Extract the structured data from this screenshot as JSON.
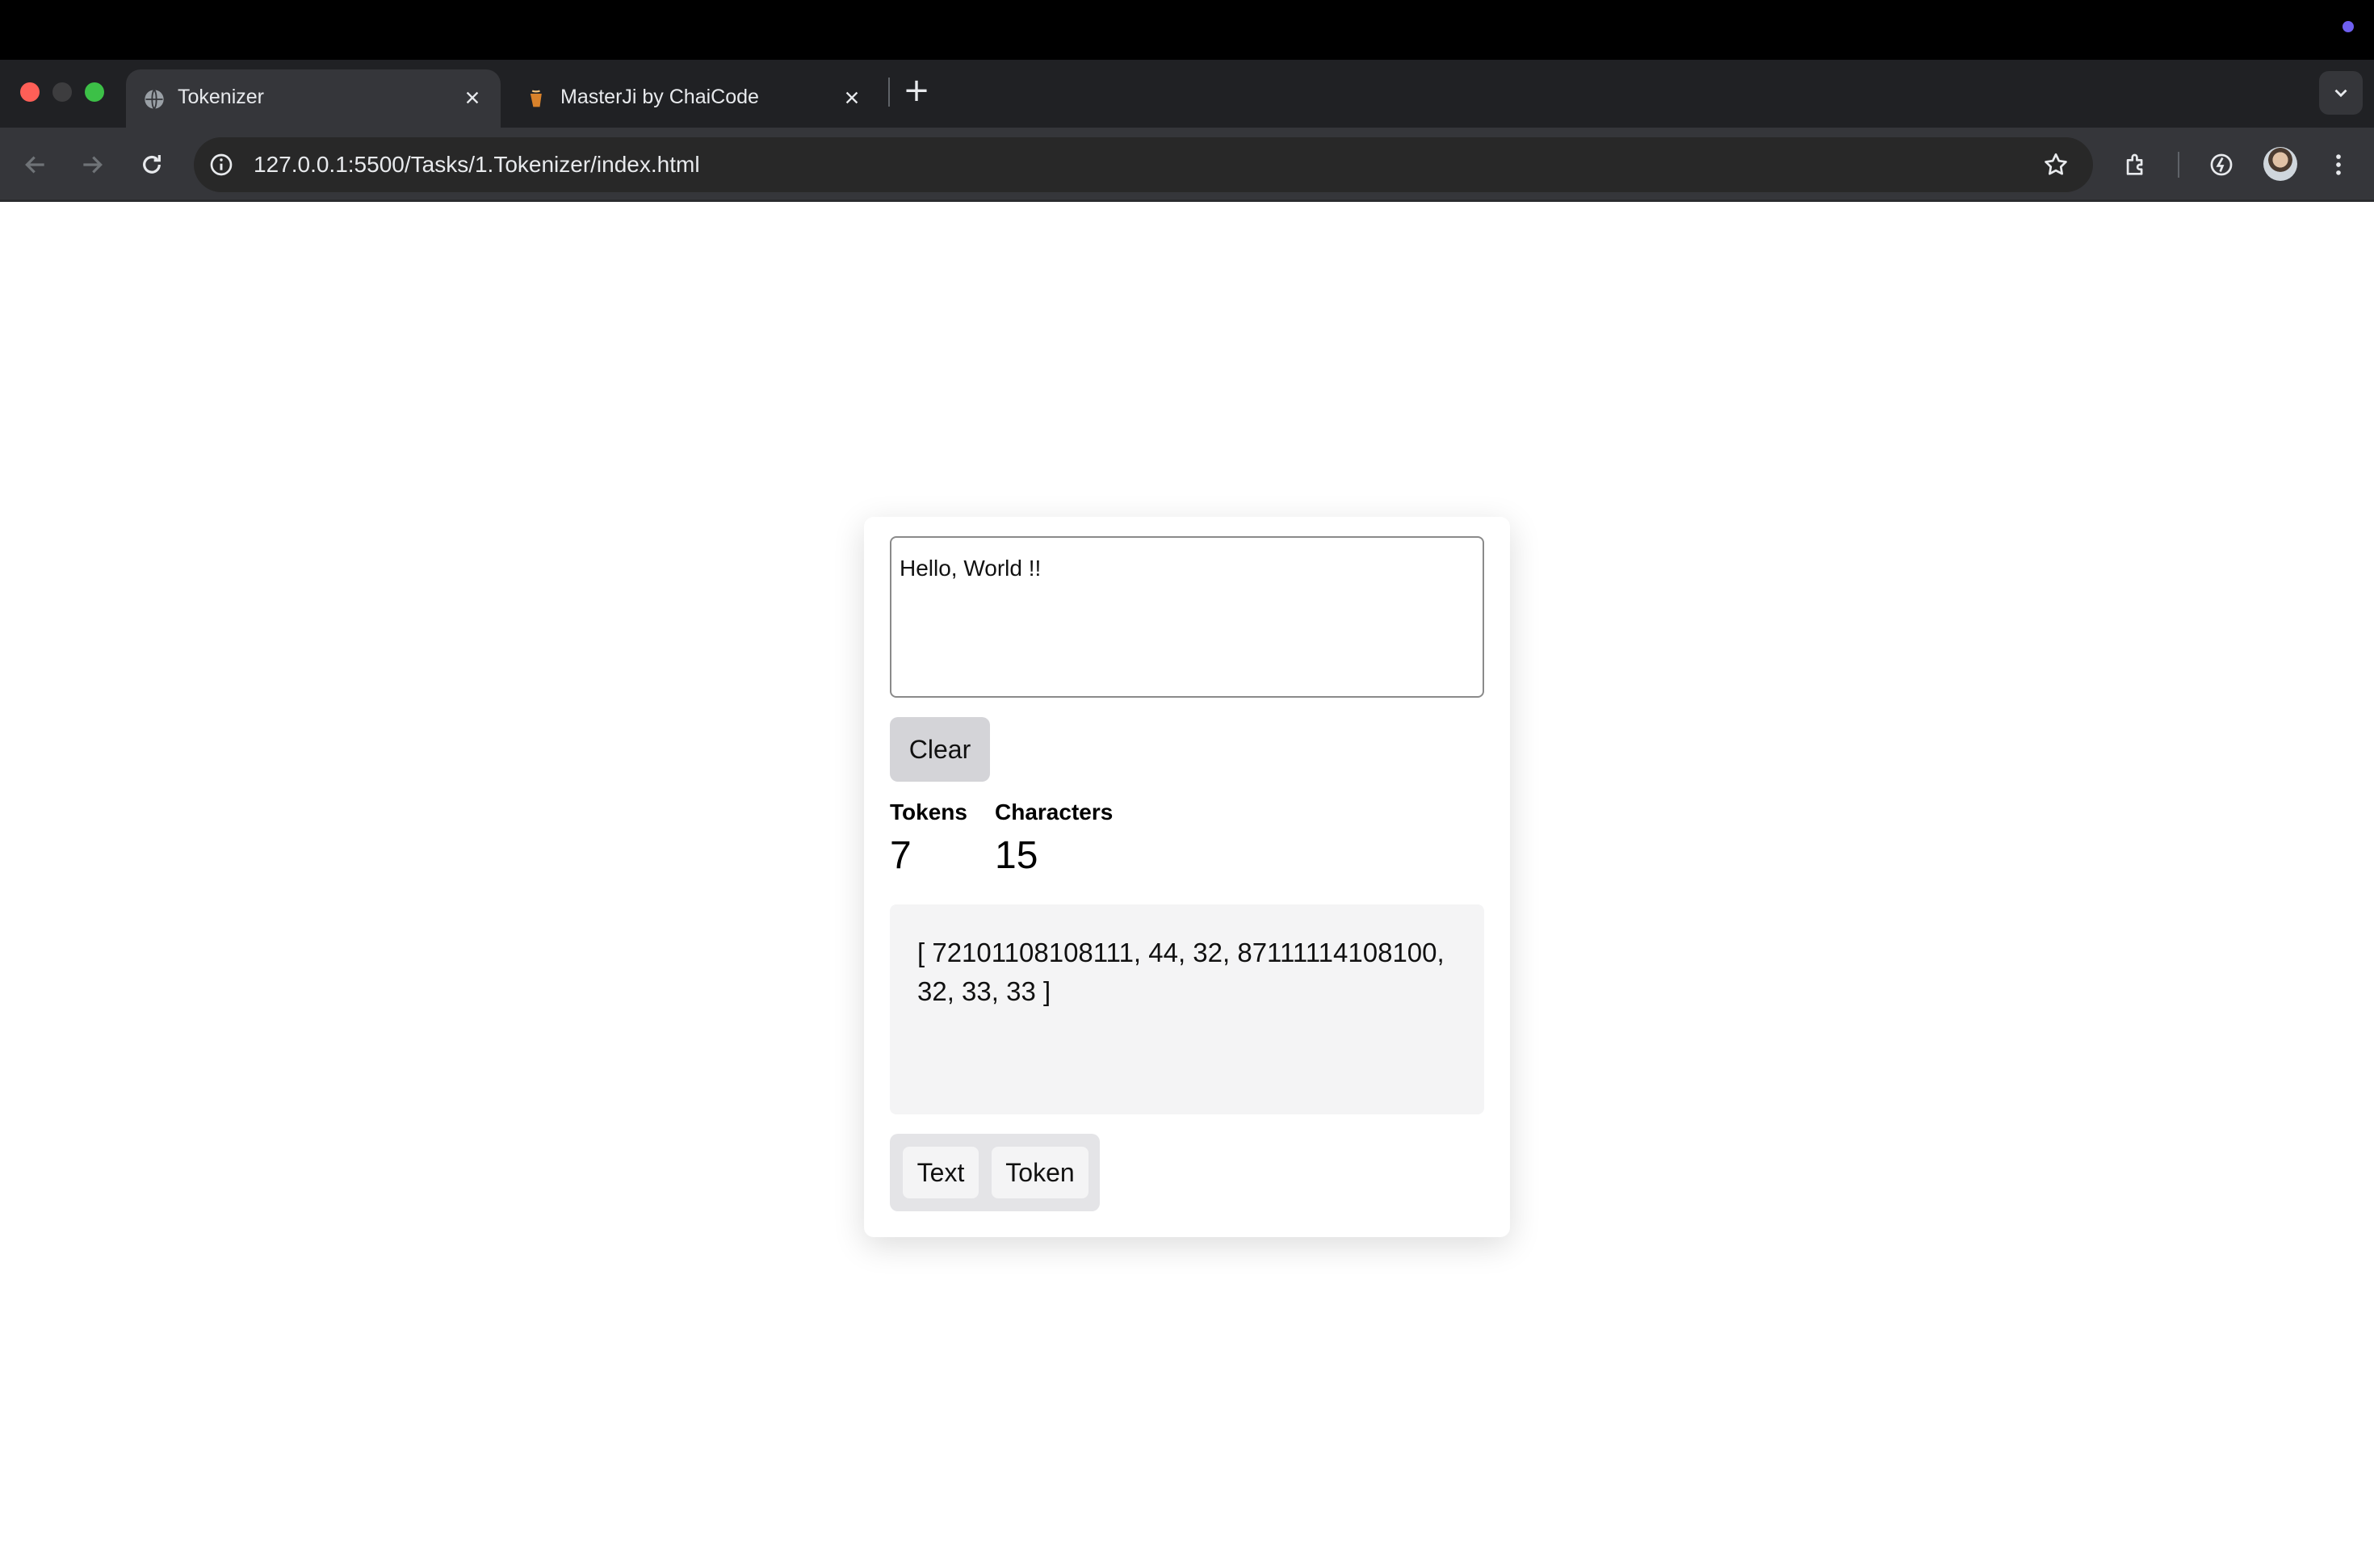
{
  "browser": {
    "tabs": [
      {
        "title": "Tokenizer",
        "active": true,
        "favicon": "globe-icon"
      },
      {
        "title": "MasterJi by ChaiCode",
        "active": false,
        "favicon": "masterji-icon"
      }
    ],
    "url": "127.0.0.1:5500/Tasks/1.Tokenizer/index.html"
  },
  "tokenizer": {
    "input_text": "Hello, World !!",
    "clear_label": "Clear",
    "tokens_label": "Tokens",
    "tokens_value": "7",
    "characters_label": "Characters",
    "characters_value": "15",
    "output": "[ 72101108108111, 44, 32, 87111114108100, 32, 33, 33 ]",
    "view_text_label": "Text",
    "view_token_label": "Token"
  }
}
